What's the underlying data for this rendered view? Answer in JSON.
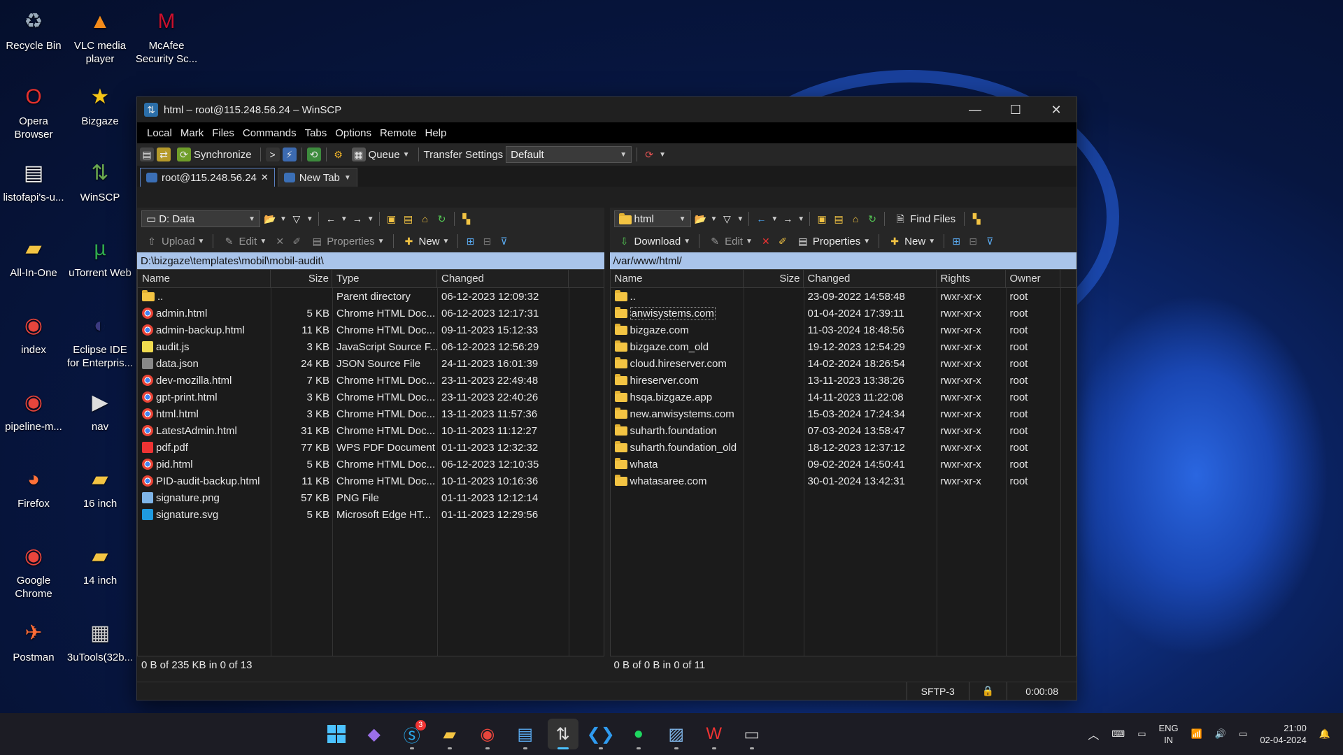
{
  "desktop_icons": [
    {
      "label": "Recycle Bin",
      "icon": "recycle-bin-icon"
    },
    {
      "label": "VLC media player",
      "icon": "vlc-icon"
    },
    {
      "label": "McAfee Security Sc...",
      "icon": "mcafee-icon"
    },
    {
      "label": "Opera Browser",
      "icon": "opera-icon"
    },
    {
      "label": "Bizgaze",
      "icon": "bizgaze-icon"
    },
    {
      "label": "listofapi's-u...",
      "icon": "document-icon"
    },
    {
      "label": "WinSCP",
      "icon": "winscp-icon"
    },
    {
      "label": "All-In-One",
      "icon": "folder-icon"
    },
    {
      "label": "uTorrent Web",
      "icon": "utorrent-icon"
    },
    {
      "label": "index",
      "icon": "chrome-icon"
    },
    {
      "label": "Eclipse IDE for Enterpris...",
      "icon": "eclipse-icon"
    },
    {
      "label": "pipeline-m...",
      "icon": "chrome-icon"
    },
    {
      "label": "nav",
      "icon": "video-icon"
    },
    {
      "label": "Firefox",
      "icon": "firefox-icon"
    },
    {
      "label": "16 inch",
      "icon": "folder-icon"
    },
    {
      "label": "Google Chrome",
      "icon": "chrome-icon"
    },
    {
      "label": "14 inch",
      "icon": "folder-icon"
    },
    {
      "label": "Postman",
      "icon": "postman-icon"
    },
    {
      "label": "3uTools(32b...",
      "icon": "3utools-icon"
    }
  ],
  "window": {
    "title": "html – root@115.248.56.24 – WinSCP",
    "menu": [
      "Local",
      "Mark",
      "Files",
      "Commands",
      "Tabs",
      "Options",
      "Remote",
      "Help"
    ],
    "toolbar": {
      "synchronize": "Synchronize",
      "queue": "Queue",
      "transfer_settings": "Transfer Settings",
      "transfer_default": "Default"
    },
    "tabs": [
      {
        "label": "root@115.248.56.24"
      },
      {
        "label": "New Tab"
      }
    ],
    "left": {
      "drive": "D: Data",
      "upload": "Upload",
      "edit": "Edit",
      "properties": "Properties",
      "new": "New",
      "path": "D:\\bizgaze\\templates\\mobil\\mobil-audit\\",
      "columns": [
        "Name",
        "Size",
        "Type",
        "Changed"
      ],
      "rows": [
        {
          "name": "..",
          "size": "",
          "type": "Parent directory",
          "changed": "06-12-2023 12:09:32",
          "kind": "parent"
        },
        {
          "name": "admin.html",
          "size": "5 KB",
          "type": "Chrome HTML Doc...",
          "changed": "06-12-2023 12:17:31",
          "kind": "chrome"
        },
        {
          "name": "admin-backup.html",
          "size": "11 KB",
          "type": "Chrome HTML Doc...",
          "changed": "09-11-2023 15:12:33",
          "kind": "chrome"
        },
        {
          "name": "audit.js",
          "size": "3 KB",
          "type": "JavaScript Source F...",
          "changed": "06-12-2023 12:56:29",
          "kind": "js"
        },
        {
          "name": "data.json",
          "size": "24 KB",
          "type": "JSON Source File",
          "changed": "24-11-2023 16:01:39",
          "kind": "json"
        },
        {
          "name": "dev-mozilla.html",
          "size": "7 KB",
          "type": "Chrome HTML Doc...",
          "changed": "23-11-2023 22:49:48",
          "kind": "chrome"
        },
        {
          "name": "gpt-print.html",
          "size": "3 KB",
          "type": "Chrome HTML Doc...",
          "changed": "23-11-2023 22:40:26",
          "kind": "chrome"
        },
        {
          "name": "html.html",
          "size": "3 KB",
          "type": "Chrome HTML Doc...",
          "changed": "13-11-2023 11:57:36",
          "kind": "chrome"
        },
        {
          "name": "LatestAdmin.html",
          "size": "31 KB",
          "type": "Chrome HTML Doc...",
          "changed": "10-11-2023 11:12:27",
          "kind": "chrome"
        },
        {
          "name": "pdf.pdf",
          "size": "77 KB",
          "type": "WPS PDF Document",
          "changed": "01-11-2023 12:32:32",
          "kind": "pdf"
        },
        {
          "name": "pid.html",
          "size": "5 KB",
          "type": "Chrome HTML Doc...",
          "changed": "06-12-2023 12:10:35",
          "kind": "chrome"
        },
        {
          "name": "PID-audit-backup.html",
          "size": "11 KB",
          "type": "Chrome HTML Doc...",
          "changed": "10-11-2023 10:16:36",
          "kind": "chrome"
        },
        {
          "name": "signature.png",
          "size": "57 KB",
          "type": "PNG File",
          "changed": "01-11-2023 12:12:14",
          "kind": "png"
        },
        {
          "name": "signature.svg",
          "size": "5 KB",
          "type": "Microsoft Edge HT...",
          "changed": "01-11-2023 12:29:56",
          "kind": "edge"
        }
      ],
      "status": "0 B of 235 KB in 0 of 13"
    },
    "right": {
      "dir": "html",
      "download": "Download",
      "edit": "Edit",
      "properties": "Properties",
      "new": "New",
      "find_files": "Find Files",
      "path": "/var/www/html/",
      "columns": [
        "Name",
        "Size",
        "Changed",
        "Rights",
        "Owner"
      ],
      "rows": [
        {
          "name": "..",
          "size": "",
          "changed": "23-09-2022 14:58:48",
          "rights": "rwxr-xr-x",
          "owner": "root"
        },
        {
          "name": "anwisystems.com",
          "size": "",
          "changed": "01-04-2024 17:39:11",
          "rights": "rwxr-xr-x",
          "owner": "root"
        },
        {
          "name": "bizgaze.com",
          "size": "",
          "changed": "11-03-2024 18:48:56",
          "rights": "rwxr-xr-x",
          "owner": "root"
        },
        {
          "name": "bizgaze.com_old",
          "size": "",
          "changed": "19-12-2023 12:54:29",
          "rights": "rwxr-xr-x",
          "owner": "root"
        },
        {
          "name": "cloud.hireserver.com",
          "size": "",
          "changed": "14-02-2024 18:26:54",
          "rights": "rwxr-xr-x",
          "owner": "root"
        },
        {
          "name": "hireserver.com",
          "size": "",
          "changed": "13-11-2023 13:38:26",
          "rights": "rwxr-xr-x",
          "owner": "root"
        },
        {
          "name": "hsqa.bizgaze.app",
          "size": "",
          "changed": "14-11-2023 11:22:08",
          "rights": "rwxr-xr-x",
          "owner": "root"
        },
        {
          "name": "new.anwisystems.com",
          "size": "",
          "changed": "15-03-2024 17:24:34",
          "rights": "rwxr-xr-x",
          "owner": "root"
        },
        {
          "name": "suharth.foundation",
          "size": "",
          "changed": "07-03-2024 13:58:47",
          "rights": "rwxr-xr-x",
          "owner": "root"
        },
        {
          "name": "suharth.foundation_old",
          "size": "",
          "changed": "18-12-2023 12:37:12",
          "rights": "rwxr-xr-x",
          "owner": "root"
        },
        {
          "name": "whata",
          "size": "",
          "changed": "09-02-2024 14:50:41",
          "rights": "rwxr-xr-x",
          "owner": "root"
        },
        {
          "name": "whatasaree.com",
          "size": "",
          "changed": "30-01-2024 13:42:31",
          "rights": "rwxr-xr-x",
          "owner": "root"
        }
      ],
      "status": "0 B of 0 B in 0 of 11"
    },
    "bottom": {
      "protocol": "SFTP-3",
      "timer": "0:00:08"
    }
  },
  "taskbar": {
    "skype_badge": "3",
    "lang": "ENG",
    "region": "IN",
    "time": "21:00",
    "date": "02-04-2024"
  }
}
